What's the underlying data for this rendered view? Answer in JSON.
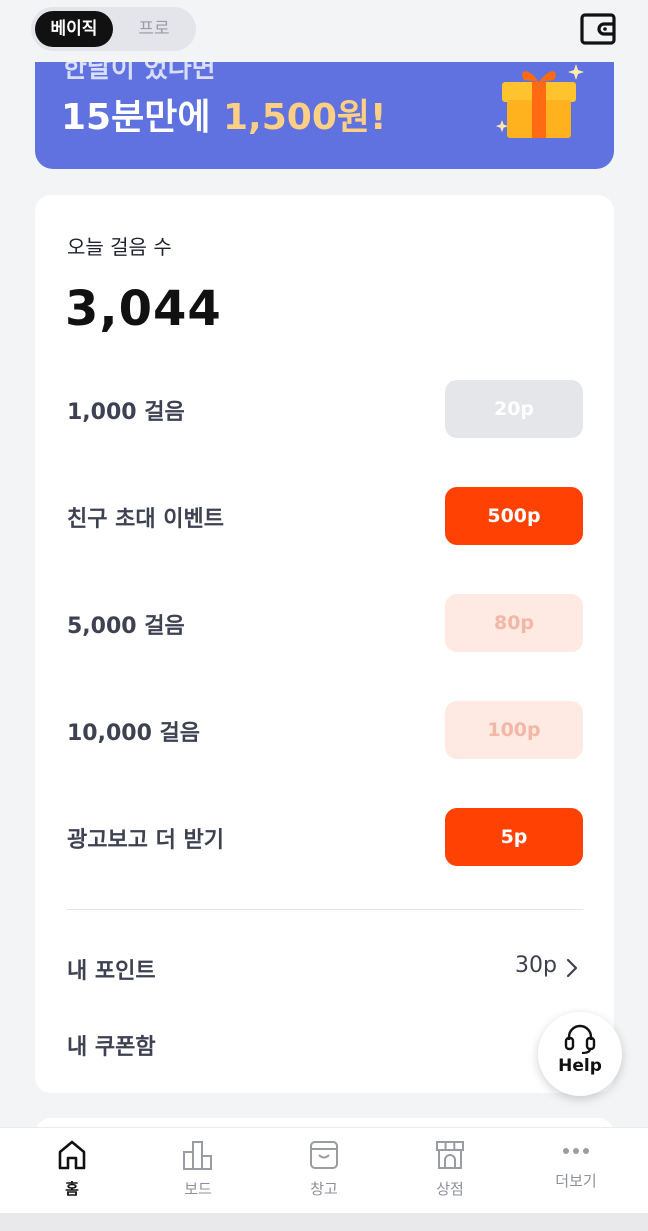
{
  "mode_toggle": {
    "active": "베이직",
    "inactive": "프로"
  },
  "banner": {
    "top_text": "한달이 었다면",
    "main_prefix": "15분만에 ",
    "main_highlight": "1,500원!"
  },
  "steps": {
    "label": "오늘 걸음 수",
    "count": "3,044"
  },
  "rewards": [
    {
      "label": "1,000 걸음",
      "button": "20p",
      "state": "disabled"
    },
    {
      "label": "친구 초대 이벤트",
      "button": "500p",
      "state": "active"
    },
    {
      "label": "5,000 걸음",
      "button": "80p",
      "state": "locked"
    },
    {
      "label": "10,000 걸음",
      "button": "100p",
      "state": "locked"
    },
    {
      "label": "광고보고 더 받기",
      "button": "5p",
      "state": "active"
    }
  ],
  "my_points": {
    "label": "내 포인트",
    "value": "30p"
  },
  "my_coupons": {
    "label": "내 쿠폰함"
  },
  "help": {
    "label": "Help"
  },
  "nav": [
    {
      "label": "홈",
      "icon": "home-icon",
      "active": true
    },
    {
      "label": "보드",
      "icon": "bar-chart-icon",
      "active": false
    },
    {
      "label": "창고",
      "icon": "box-icon",
      "active": false
    },
    {
      "label": "상점",
      "icon": "store-icon",
      "active": false
    },
    {
      "label": "더보기",
      "icon": "more-icon",
      "active": false
    }
  ],
  "colors": {
    "accent": "#ff4204",
    "banner": "#5f72e0",
    "highlight": "#ffcf84"
  }
}
